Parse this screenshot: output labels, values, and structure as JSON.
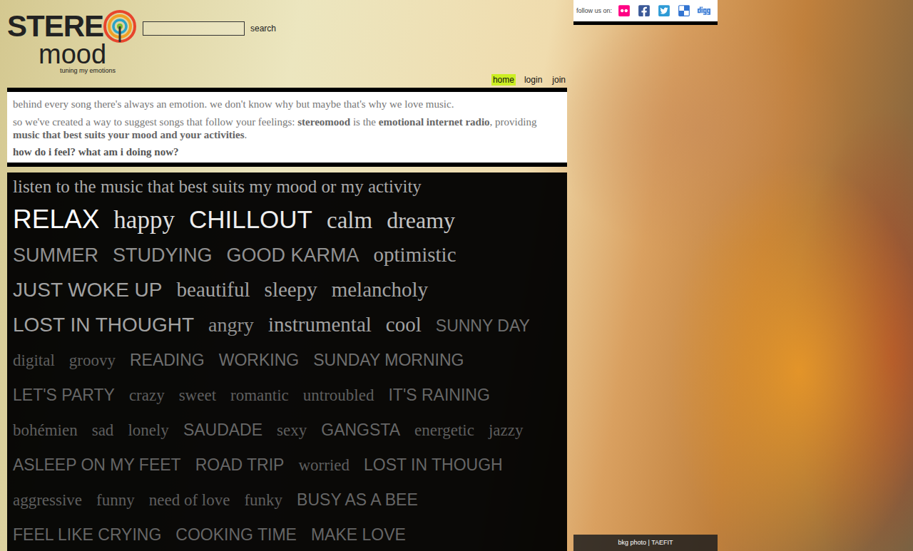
{
  "logo": {
    "top": "STERE",
    "bottom": "mood",
    "tagline": "tuning my emotions"
  },
  "search": {
    "value": "",
    "button": "search"
  },
  "nav": [
    {
      "label": "home",
      "selected": true
    },
    {
      "label": "login",
      "selected": false
    },
    {
      "label": "join",
      "selected": false
    }
  ],
  "intro": {
    "line1": "behind every song there's always an emotion. we don't know why but maybe that's why we love music.",
    "line2": [
      {
        "text": "so we've created a way to suggest songs that follow your feelings: ",
        "bold": false
      },
      {
        "text": "stereomood",
        "bold": true
      },
      {
        "text": " is the ",
        "bold": false
      },
      {
        "text": "emotional internet radio",
        "bold": true
      },
      {
        "text": ", providing ",
        "bold": false
      },
      {
        "text": "music that best suits your mood and your activities",
        "bold": true
      },
      {
        "text": ".",
        "bold": false
      }
    ],
    "question": "how do i feel? what am i doing now?"
  },
  "tags": {
    "heading": "listen to the music that best suits my mood or my activity",
    "rows": [
      [
        {
          "label": "RELAX",
          "kind": "sans",
          "level": 1.0
        },
        {
          "label": "happy",
          "kind": "serif",
          "level": 0.8
        },
        {
          "label": "CHILLOUT",
          "kind": "sans",
          "level": 0.9
        },
        {
          "label": "calm",
          "kind": "serif",
          "level": 0.7
        },
        {
          "label": "dreamy",
          "kind": "serif",
          "level": 0.65
        }
      ],
      [
        {
          "label": "SUMMER",
          "kind": "sans",
          "level": 0.35
        },
        {
          "label": "STUDYING",
          "kind": "sans",
          "level": 0.35
        },
        {
          "label": "GOOD KARMA",
          "kind": "sans",
          "level": 0.35
        },
        {
          "label": "optimistic",
          "kind": "serif",
          "level": 0.45
        }
      ],
      [
        {
          "label": "JUST WOKE UP",
          "kind": "sans",
          "level": 0.45
        },
        {
          "label": "beautiful",
          "kind": "serif",
          "level": 0.45
        },
        {
          "label": "sleepy",
          "kind": "serif",
          "level": 0.45
        },
        {
          "label": "melancholy",
          "kind": "serif",
          "level": 0.45
        }
      ],
      [
        {
          "label": "LOST IN THOUGHT",
          "kind": "sans",
          "level": 0.45
        },
        {
          "label": "angry",
          "kind": "serif",
          "level": 0.35
        },
        {
          "label": "instrumental",
          "kind": "serif",
          "level": 0.45
        },
        {
          "label": "cool",
          "kind": "serif",
          "level": 0.45
        },
        {
          "label": "SUNNY DAY",
          "kind": "sans",
          "level": 0.15
        }
      ],
      [
        {
          "label": "digital",
          "kind": "serif",
          "level": 0.05
        },
        {
          "label": "groovy",
          "kind": "serif",
          "level": 0.05
        },
        {
          "label": "READING",
          "kind": "sans",
          "level": 0.15
        },
        {
          "label": "WORKING",
          "kind": "sans",
          "level": 0.15
        },
        {
          "label": "SUNDAY MORNING",
          "kind": "sans",
          "level": 0.15
        }
      ],
      [
        {
          "label": "LET'S PARTY",
          "kind": "sans",
          "level": 0.1
        },
        {
          "label": "crazy",
          "kind": "serif",
          "level": 0.05
        },
        {
          "label": "sweet",
          "kind": "serif",
          "level": 0.05
        },
        {
          "label": "romantic",
          "kind": "serif",
          "level": 0.05
        },
        {
          "label": "untroubled",
          "kind": "serif",
          "level": 0.05
        },
        {
          "label": "IT'S RAINING",
          "kind": "sans",
          "level": 0.1
        }
      ],
      [
        {
          "label": "bohémien",
          "kind": "serif",
          "level": 0.05
        },
        {
          "label": "sad",
          "kind": "serif",
          "level": 0.05
        },
        {
          "label": "lonely",
          "kind": "serif",
          "level": 0.05
        },
        {
          "label": "SAUDADE",
          "kind": "sans",
          "level": 0.1
        },
        {
          "label": "sexy",
          "kind": "serif",
          "level": 0.05
        },
        {
          "label": "GANGSTA",
          "kind": "sans",
          "level": 0.1
        },
        {
          "label": "energetic",
          "kind": "serif",
          "level": 0.05
        },
        {
          "label": "jazzy",
          "kind": "serif",
          "level": 0.05
        }
      ],
      [
        {
          "label": "ASLEEP ON MY FEET",
          "kind": "sans",
          "level": 0.1
        },
        {
          "label": "ROAD TRIP",
          "kind": "sans",
          "level": 0.1
        },
        {
          "label": "worried",
          "kind": "serif",
          "level": 0.05
        },
        {
          "label": "LOST IN THOUGH",
          "kind": "sans",
          "level": 0.1
        }
      ],
      [
        {
          "label": "aggressive",
          "kind": "serif",
          "level": 0.05
        },
        {
          "label": "funny",
          "kind": "serif",
          "level": 0.05
        },
        {
          "label": "need of love",
          "kind": "serif",
          "level": 0.05
        },
        {
          "label": "funky",
          "kind": "serif",
          "level": 0.05
        },
        {
          "label": "BUSY AS A BEE",
          "kind": "sans",
          "level": 0.1
        }
      ],
      [
        {
          "label": "FEEL LIKE CRYING",
          "kind": "sans",
          "level": 0.1
        },
        {
          "label": "COOKING TIME",
          "kind": "sans",
          "level": 0.1
        },
        {
          "label": "MAKE LOVE",
          "kind": "sans",
          "level": 0.1
        }
      ]
    ]
  },
  "follow": {
    "label": "follow us on:"
  },
  "credit": "bkg photo | TAEFIT"
}
